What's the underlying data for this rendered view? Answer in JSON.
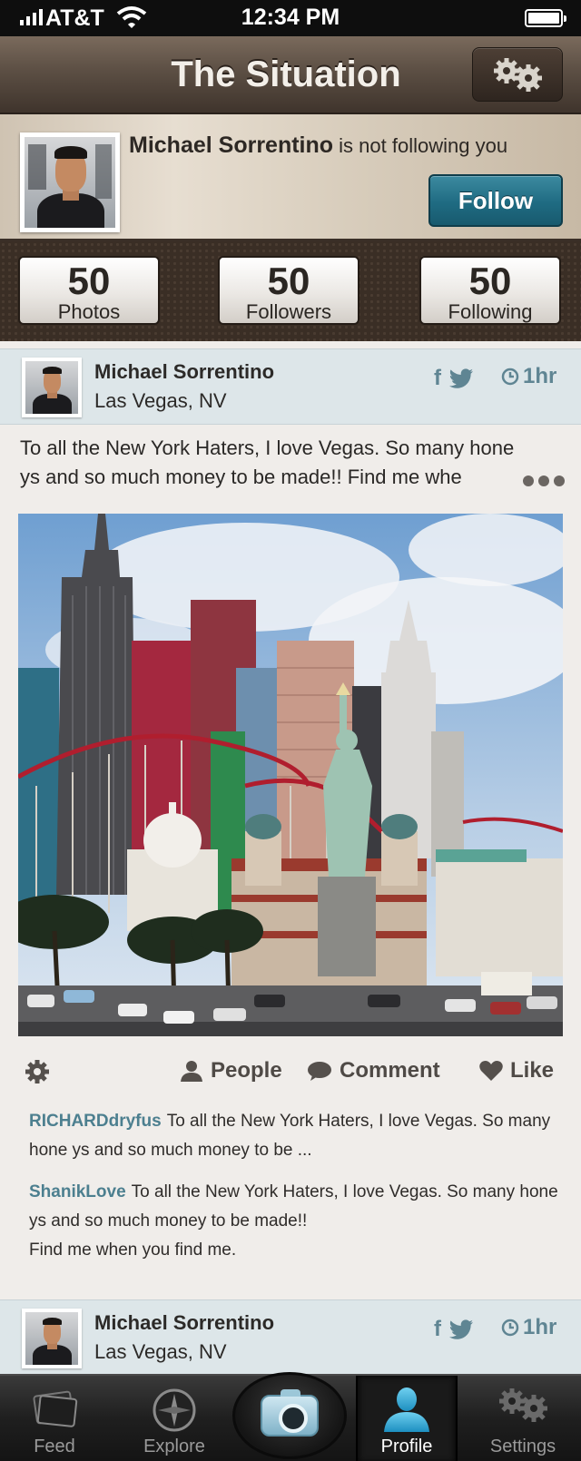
{
  "status_bar": {
    "carrier": "AT&T",
    "time": "12:34 PM"
  },
  "nav": {
    "title": "The Situation",
    "settings_icon": "gear-icon"
  },
  "profile": {
    "name": "Michael Sorrentino",
    "follow_status": "is not following you",
    "follow_button": "Follow"
  },
  "stats": [
    {
      "count": "50",
      "label": "Photos"
    },
    {
      "count": "50",
      "label": "Followers"
    },
    {
      "count": "50",
      "label": "Following"
    }
  ],
  "post": {
    "user_name": "Michael Sorrentino",
    "location": "Las Vegas, NV",
    "time_ago": "1hr",
    "text_line1": "To all the New York Haters, I love Vegas. So many hone",
    "text_line2": "ys and so much money to be made!! Find me whe",
    "actions": {
      "people": "People",
      "comment": "Comment",
      "like": "Like"
    },
    "comments": [
      {
        "user": "RICHARDdryfus",
        "text": "To all the New York Haters, I love Vegas. So many hone ys and so much money to be ..."
      },
      {
        "user": "ShanikLove",
        "text": "To all the New York Haters, I love Vegas. So many hone ys and so much money to be made!!",
        "text2": "Find me when you find me."
      }
    ]
  },
  "next_post": {
    "user_name": "Michael Sorrentino",
    "location": "Las Vegas, NV",
    "time_ago": "1hr"
  },
  "tabs": [
    {
      "label": "Feed",
      "icon": "feed-icon"
    },
    {
      "label": "Explore",
      "icon": "compass-icon"
    },
    {
      "label": "",
      "icon": "camera-icon"
    },
    {
      "label": "Profile",
      "icon": "person-icon"
    },
    {
      "label": "Settings",
      "icon": "gear-icon"
    }
  ],
  "colors": {
    "accent": "#1f6b82",
    "link": "#4c7f8f",
    "nav_brown": "#5c4f44"
  }
}
